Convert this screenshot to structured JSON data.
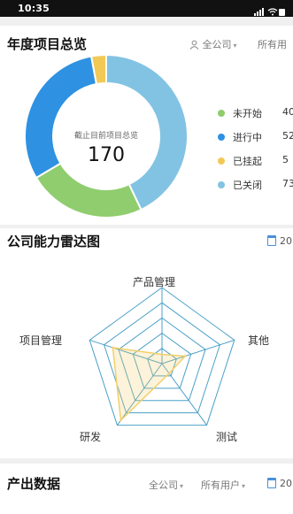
{
  "status_bar": {
    "time": "10:35"
  },
  "overview": {
    "title": "年度项目总览",
    "filter_company": "全公司",
    "filter_user": "所有用",
    "center_caption": "截止目前项目总览",
    "center_total": "170"
  },
  "chart_data": [
    {
      "type": "pie",
      "title": "",
      "total": 170,
      "series": [
        {
          "name": "未开始",
          "label": "40",
          "value": 40,
          "color": "#8fcd6e"
        },
        {
          "name": "进行中",
          "label": "52",
          "value": 52,
          "color": "#2e91e2"
        },
        {
          "name": "已挂起",
          "label": "5",
          "value": 5,
          "color": "#f3c956"
        },
        {
          "name": "已关闭",
          "label": "73",
          "value": 73,
          "color": "#82c3e3"
        }
      ]
    },
    {
      "type": "radar",
      "title": "",
      "axes": [
        "产品管理",
        "其他",
        "测试",
        "研发",
        "项目管理"
      ],
      "max": 5,
      "rings": 5,
      "series": [
        {
          "values": [
            0.6,
            1.6,
            0.8,
            4.6,
            3.4
          ],
          "color": "#f3cf6a"
        }
      ]
    }
  ],
  "radar": {
    "title": "公司能力雷达图",
    "date_label": "20"
  },
  "output": {
    "title": "产出数据",
    "filter_company": "全公司",
    "filter_user": "所有用户",
    "date_label": "20"
  },
  "colors": {
    "ring_grid": "#4aa0c8",
    "radar_fill": "#f3cf6a"
  }
}
